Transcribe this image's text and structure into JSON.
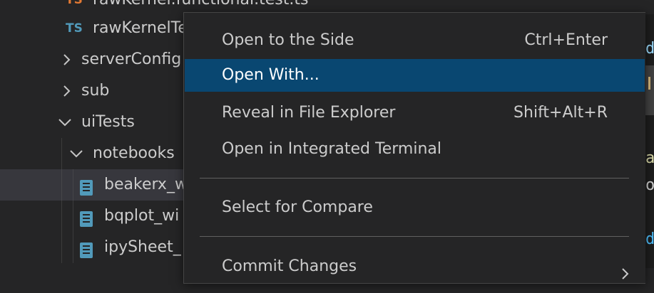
{
  "explorer": {
    "rows": [
      {
        "label": "rawKernel.functional.test.ts",
        "badge": "TS"
      },
      {
        "label": "rawKernelTe",
        "badge": "TS"
      },
      {
        "label": "serverConfig"
      },
      {
        "label": "sub"
      },
      {
        "label": "uiTests"
      },
      {
        "label": "notebooks"
      },
      {
        "label": "beakerx_w"
      },
      {
        "label": "bqplot_wi"
      },
      {
        "label": "ipySheet_"
      }
    ]
  },
  "editor": {
    "fragments": [
      "de",
      "rx",
      "ar",
      "op",
      "da"
    ]
  },
  "context_menu": {
    "items": [
      {
        "label": "Open to the Side",
        "keybinding": "Ctrl+Enter"
      },
      {
        "label": "Open With...",
        "keybinding": ""
      },
      {
        "label": "Reveal in File Explorer",
        "keybinding": "Shift+Alt+R"
      },
      {
        "label": "Open in Integrated Terminal",
        "keybinding": ""
      },
      {
        "label": "Select for Compare",
        "keybinding": ""
      },
      {
        "label": "Commit Changes",
        "keybinding": ""
      }
    ]
  },
  "colors": {
    "menu_background": "#252526",
    "menu_highlight": "#094771",
    "ts_badge": "#519aba",
    "notebook_icon": "#519aba",
    "selected_row": "#37373d"
  }
}
